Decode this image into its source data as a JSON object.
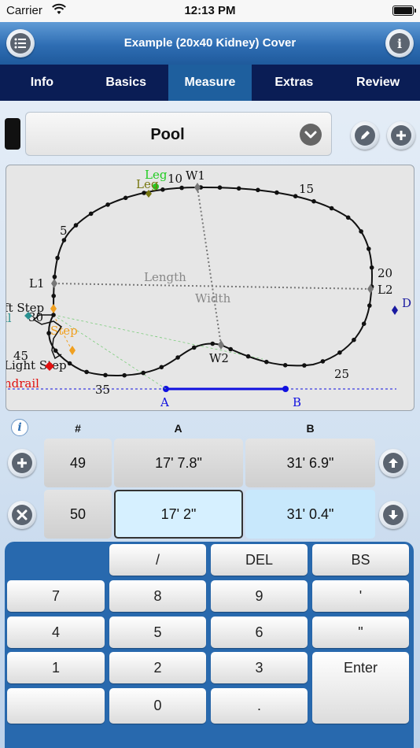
{
  "status": {
    "carrier": "Carrier",
    "time": "12:13 PM"
  },
  "header": {
    "title": "Example (20x40 Kidney) Cover"
  },
  "tabs": [
    {
      "label": "Info"
    },
    {
      "label": "Basics"
    },
    {
      "label": "Measure",
      "active": true
    },
    {
      "label": "Extras"
    },
    {
      "label": "Review"
    }
  ],
  "selector": {
    "value": "Pool"
  },
  "drawing": {
    "point_labels": {
      "n5": "5",
      "n10": "10",
      "n15": "15",
      "n20": "20",
      "n25": "25",
      "n35": "35",
      "n30": "30",
      "n45": "45",
      "w1": "W1",
      "w2": "W2",
      "l1": "L1",
      "l2": "L2",
      "a": "A",
      "b": "B"
    },
    "dimension_labels": {
      "length": "Length",
      "width": "Width"
    },
    "feature_labels": {
      "leg1": "Leg",
      "leg2": "Leg",
      "left_step": "ft Step",
      "rail": "il",
      "step": "Step",
      "right_step": "Light Step",
      "handrail": "ndrail",
      "d": "D"
    }
  },
  "grid": {
    "headers": {
      "num": "#",
      "a": "A",
      "b": "B"
    },
    "rows": [
      {
        "num": "49",
        "a": "17' 7.8\"",
        "b": "31' 6.9\""
      },
      {
        "num": "50",
        "a": "17' 2\"",
        "b": "31' 0.4\""
      }
    ]
  },
  "keypad": {
    "slash": "/",
    "del": "DEL",
    "bs": "BS",
    "k7": "7",
    "k8": "8",
    "k9": "9",
    "apos": "'",
    "k4": "4",
    "k5": "5",
    "k6": "6",
    "quote": "\"",
    "k1": "1",
    "k2": "2",
    "k3": "3",
    "enter": "Enter",
    "k0": "0",
    "dot": "."
  },
  "colors": {
    "accent": "#2869ae",
    "tab_bar": "#0a1d55",
    "baseline": "#1010e0"
  },
  "icons": [
    "wifi-icon",
    "battery-icon",
    "menu-icon",
    "info-icon",
    "chevron-down-icon",
    "pencil-icon",
    "plus-icon",
    "arrow-up-icon",
    "arrow-down-icon",
    "close-icon"
  ]
}
